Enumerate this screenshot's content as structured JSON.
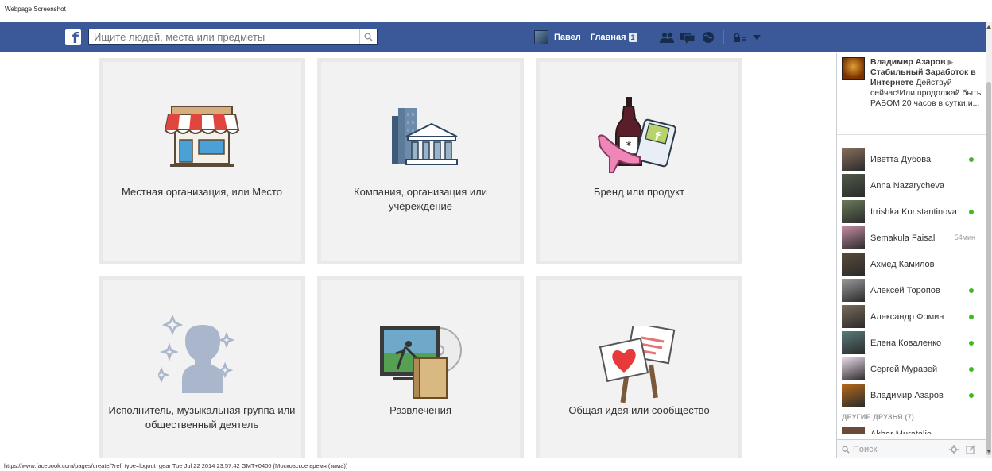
{
  "capture_title": "Webpage Screenshot",
  "topbar": {
    "search_placeholder": "Ищите людей, места или предметы",
    "user_name": "Павел",
    "home_label": "Главная",
    "home_badge": "1",
    "brand_color": "#3b5998"
  },
  "categories": [
    {
      "label": "Местная организация, или Место",
      "icon": "storefront-icon"
    },
    {
      "label": "Компания, организация или учереждение",
      "icon": "company-buildings-icon"
    },
    {
      "label": "Бренд или продукт",
      "icon": "brand-product-icon"
    },
    {
      "label": "Исполнитель, музыкальная группа или общественный деятель",
      "icon": "artist-silhouette-icon"
    },
    {
      "label": "Развлечения",
      "icon": "entertainment-icon"
    },
    {
      "label": "Общая идея или сообщество",
      "icon": "community-signs-icon"
    }
  ],
  "sidebar": {
    "ticker": {
      "author": "Владимир Азаров",
      "arrow": "▶",
      "page": "Стабильный Заработок в Интернете",
      "text": "Действуй сейчас!Или продолжай быть РАБОМ 20 часов в сутки,и..."
    },
    "friends": [
      {
        "name": "Иветта Дубова",
        "online": true,
        "time": ""
      },
      {
        "name": "Anna Nazarycheva",
        "online": false,
        "time": ""
      },
      {
        "name": "Irrishka Konstantinova",
        "online": true,
        "time": ""
      },
      {
        "name": "Semakula Faisal",
        "online": false,
        "time": "54мин"
      },
      {
        "name": "Ахмед Камилов",
        "online": false,
        "time": ""
      },
      {
        "name": "Алексей Торопов",
        "online": true,
        "time": ""
      },
      {
        "name": "Александр Фомин",
        "online": true,
        "time": ""
      },
      {
        "name": "Елена Коваленко",
        "online": true,
        "time": ""
      },
      {
        "name": "Сергей Муравей",
        "online": true,
        "time": ""
      },
      {
        "name": "Владимир Азаров",
        "online": true,
        "time": ""
      }
    ],
    "others_header": "ДРУГИЕ ДРУЗЬЯ (7)",
    "partial_friend": "Akbar Muratalie...",
    "chat_search_placeholder": "Поиск"
  },
  "status_bar": "https://www.facebook.com/pages/create/?ref_type=logout_gear Tue Jul 22 2014 23:57:42 GMT+0400 (Московское время (зима))"
}
